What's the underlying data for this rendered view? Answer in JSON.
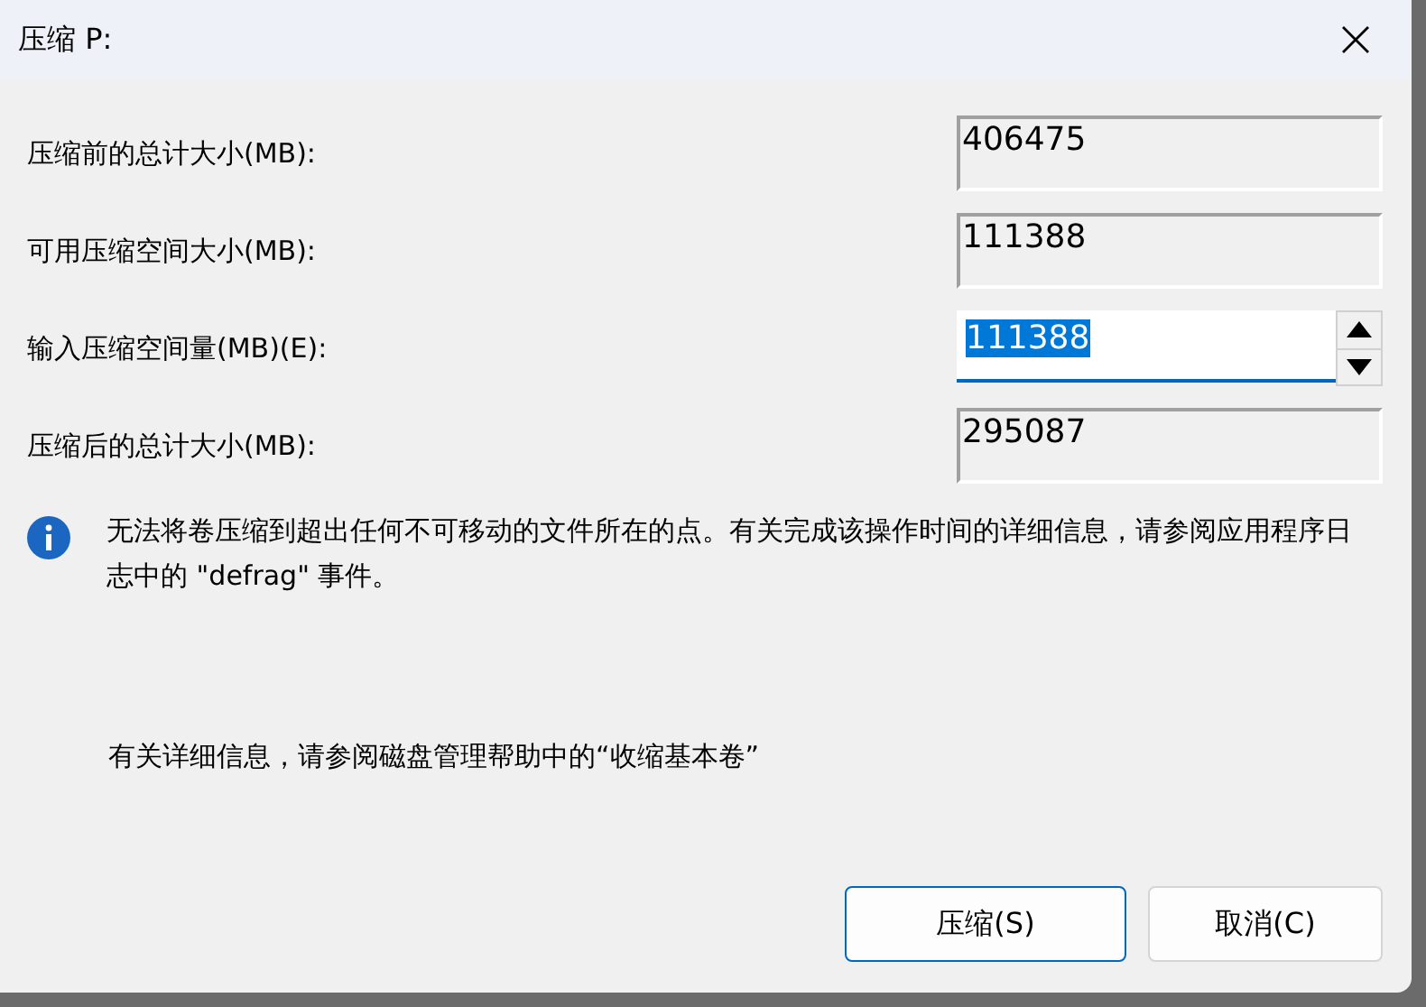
{
  "window": {
    "title": "压缩 P:"
  },
  "fields": [
    {
      "kind": "readonly",
      "label": "压缩前的总计大小(MB):",
      "value": "406475"
    },
    {
      "kind": "readonly",
      "label": "可用压缩空间大小(MB):",
      "value": "111388"
    },
    {
      "kind": "spinner",
      "label": "输入压缩空间量(MB)(E):",
      "value": "111388"
    },
    {
      "kind": "readonly",
      "label": "压缩后的总计大小(MB):",
      "value": "295087"
    }
  ],
  "info": "无法将卷压缩到超出任何不可移动的文件所在的点。有关完成该操作时间的详细信息，请参阅应用程序日志中的 \"defrag\" 事件。",
  "help": "有关详细信息，请参阅磁盘管理帮助中的“收缩基本卷”",
  "buttons": [
    {
      "label": "压缩(S)",
      "selected": true
    },
    {
      "label": "取消(C)",
      "selected": false
    }
  ]
}
